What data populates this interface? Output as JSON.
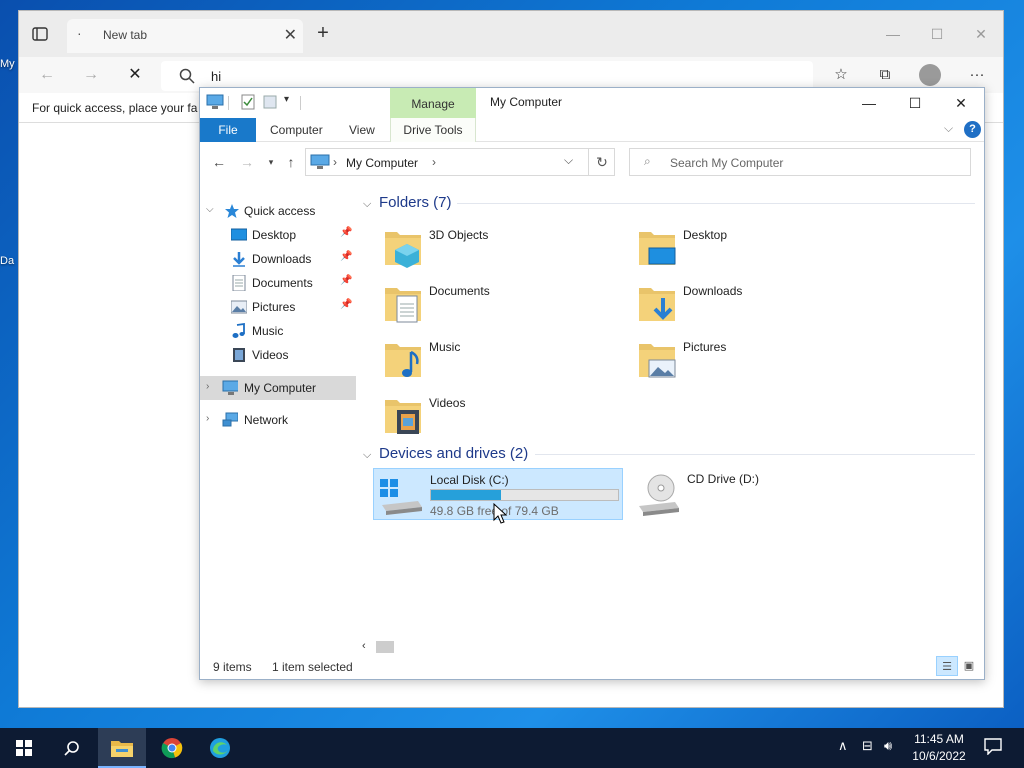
{
  "desktop": {
    "frag1": "My",
    "frag2": "Da"
  },
  "browser": {
    "tab_title": "New tab",
    "tab_favicon": "·",
    "address_value": "hi",
    "favorites_hint": "For quick access, place your fa"
  },
  "explorer": {
    "window_title": "My Computer",
    "contextual_tab": "Manage",
    "ribbon": {
      "file": "File",
      "computer": "Computer",
      "view": "View",
      "drive_tools": "Drive Tools"
    },
    "address": {
      "crumb": "My Computer"
    },
    "search_placeholder": "Search My Computer",
    "nav": {
      "quick_access": "Quick access",
      "items": [
        {
          "label": "Desktop",
          "icon": "desktop-icon",
          "pinned": true
        },
        {
          "label": "Downloads",
          "icon": "downloads-icon",
          "pinned": true
        },
        {
          "label": "Documents",
          "icon": "documents-icon",
          "pinned": true
        },
        {
          "label": "Pictures",
          "icon": "pictures-icon",
          "pinned": true
        },
        {
          "label": "Music",
          "icon": "music-icon",
          "pinned": false
        },
        {
          "label": "Videos",
          "icon": "videos-icon",
          "pinned": false
        }
      ],
      "my_computer": "My Computer",
      "network": "Network"
    },
    "folders": {
      "header": "Folders (7)",
      "items": [
        "3D Objects",
        "Desktop",
        "Documents",
        "Downloads",
        "Music",
        "Pictures",
        "Videos"
      ]
    },
    "devices": {
      "header": "Devices and drives (2)",
      "drives": [
        {
          "label": "Local Disk (C:)",
          "free_text": "49.8 GB free of 79.4 GB",
          "used_fraction": 0.373
        },
        {
          "label": "CD Drive (D:)"
        }
      ]
    },
    "status": {
      "items": "9 items",
      "selected": "1 item selected"
    }
  },
  "taskbar": {
    "time": "11:45 AM",
    "date": "10/6/2022"
  },
  "colors": {
    "accent": "#1979ca",
    "manage_tab": "#c8ebb4",
    "selection": "#cce8ff",
    "drive_bar": "#26a0da"
  }
}
